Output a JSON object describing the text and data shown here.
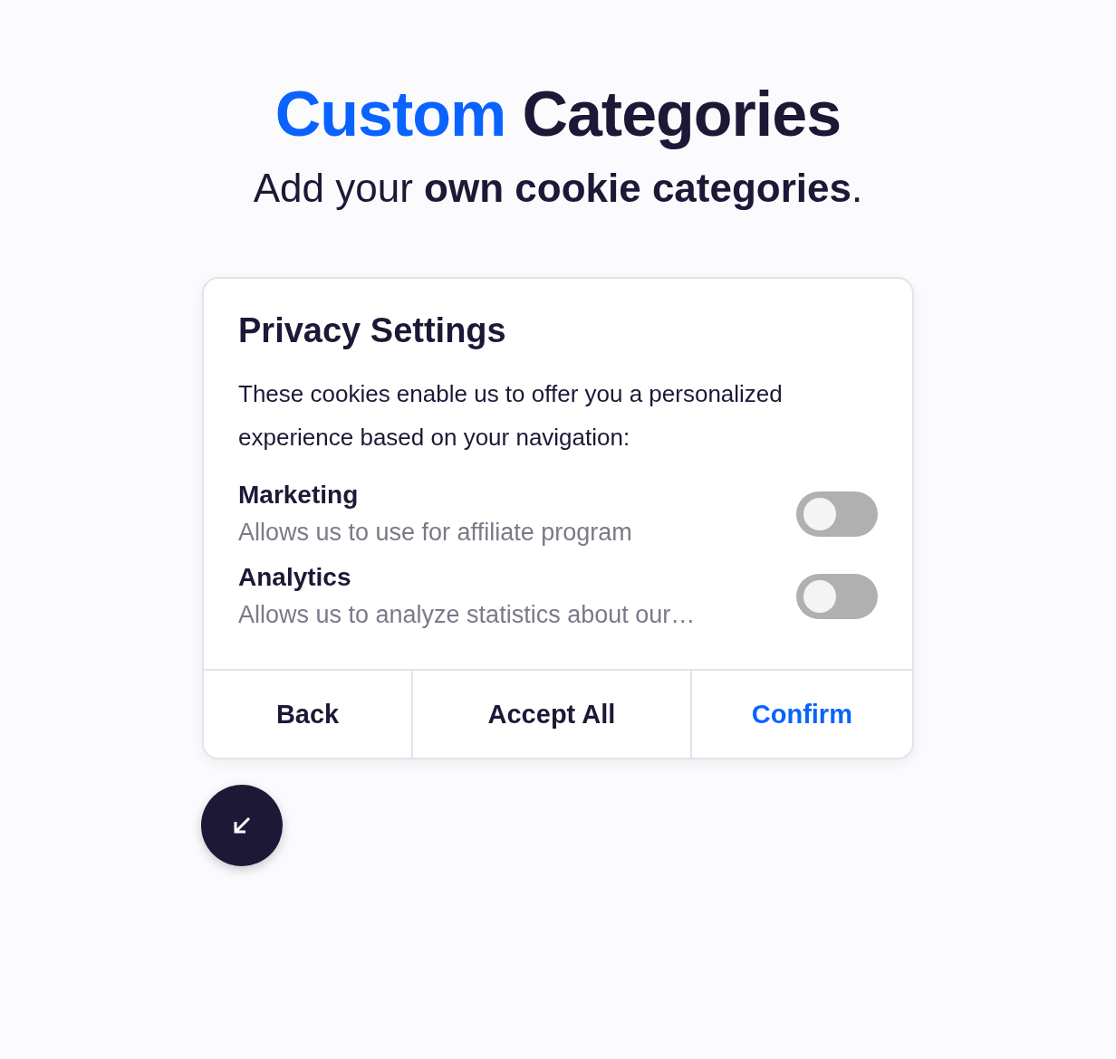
{
  "heading": {
    "accent": "Custom",
    "rest": "Categories"
  },
  "subtitle": "Add your **own cookie categories**.",
  "dialog": {
    "title": "Privacy Settings",
    "description": "These cookies enable us to offer you a personalized experience based on your navigation:",
    "categories": [
      {
        "name": "Marketing",
        "description": "Allows us to use for affiliate program",
        "on": false
      },
      {
        "name": "Analytics",
        "description": "Allows us to analyze statistics about our…",
        "on": false
      }
    ],
    "buttons": [
      {
        "label": "Back",
        "kind": "default"
      },
      {
        "label": "Accept All",
        "kind": "default"
      },
      {
        "label": "Confirm",
        "kind": "primary"
      }
    ]
  }
}
